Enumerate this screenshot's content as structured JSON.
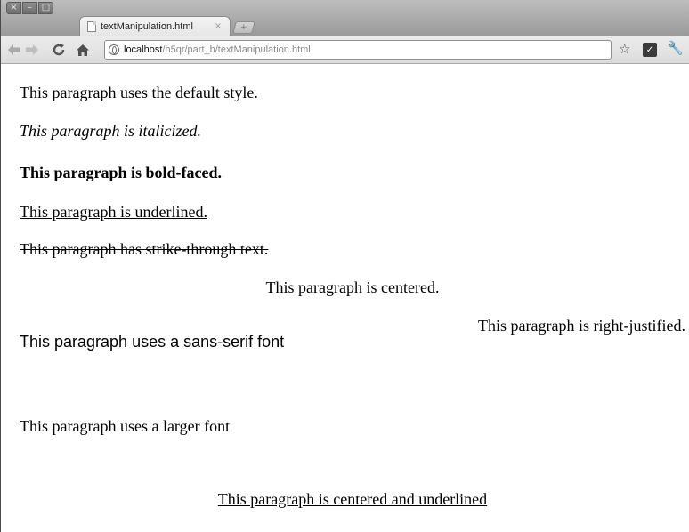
{
  "window": {
    "controls": [
      "×",
      "–",
      "□"
    ]
  },
  "tab": {
    "title": "textManipulation.html",
    "close": "×",
    "new_tab": "+"
  },
  "toolbar": {
    "back_icon": "back-arrow-icon",
    "forward_icon": "forward-arrow-icon",
    "reload_icon": "reload-icon",
    "home_icon": "home-icon",
    "url_host": "localhost",
    "url_path": "/h5qr/part_b/textManipulation.html",
    "bookmark_icon": "star-icon",
    "extension_icon": "extension-icon",
    "menu_icon": "wrench-icon"
  },
  "content": {
    "p_default": "This paragraph uses the default style.",
    "p_italic": "This paragraph is italicized.",
    "p_bold": "This paragraph is bold-faced.",
    "p_underline": "This paragraph is underlined.",
    "p_strike": "This paragraph has strike-through text.",
    "p_center": "This paragraph is centered.",
    "p_right": "This paragraph is right-justified.",
    "p_sans": "This paragraph uses a sans-serif font",
    "p_large": "This paragraph uses a larger font",
    "p_center_under": "This paragraph is centered and underlined"
  }
}
